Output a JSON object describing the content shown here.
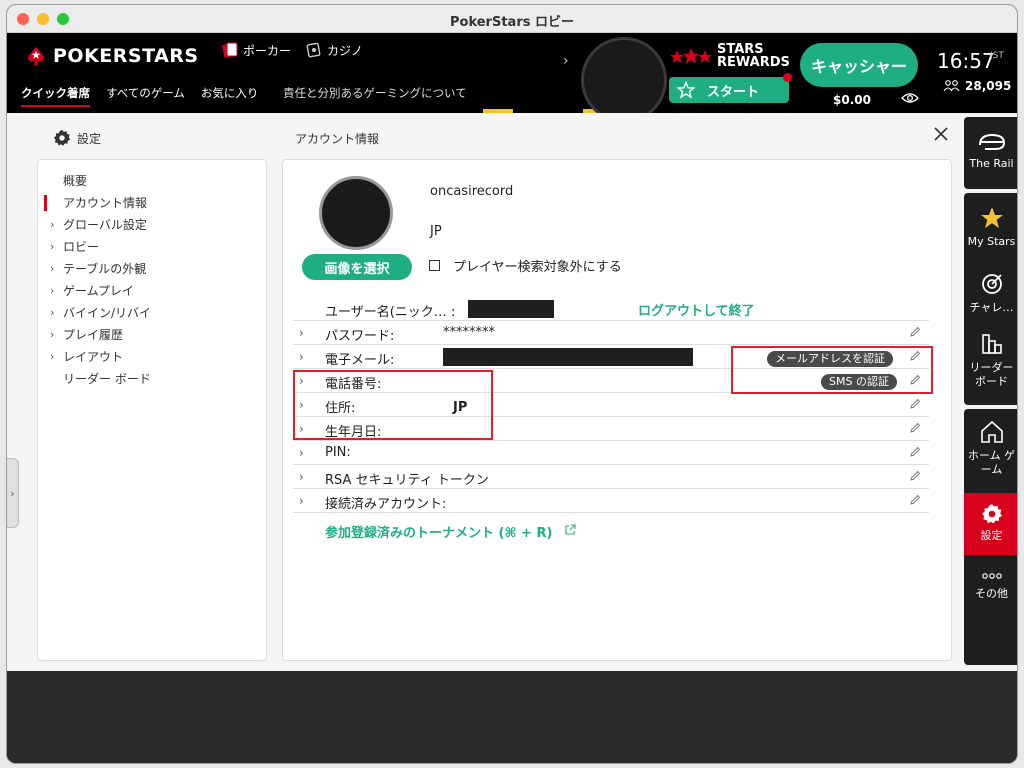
{
  "window": {
    "title": "PokerStars ロビー"
  },
  "header": {
    "logo_text": "POKERSTARS",
    "games": [
      {
        "label": "ポーカー",
        "icon": "cards-icon"
      },
      {
        "label": "カジノ",
        "icon": "casino-icon"
      }
    ],
    "tabs": [
      {
        "label": "クイック着席",
        "active": true
      },
      {
        "label": "すべてのゲーム"
      },
      {
        "label": "お気に入り"
      }
    ],
    "responsible_gaming": "責任と分別あるゲーミングについて",
    "rewards_line1": "STARS",
    "rewards_line2": "REWARDS",
    "start_label": "スタート",
    "cashier_label": "キャッシャー",
    "balance": "$0.00",
    "time": "16:57",
    "timezone": "JST",
    "players_online": "28,095"
  },
  "settings": {
    "panel_title": "設定",
    "section_title": "アカウント情報",
    "nav": [
      {
        "label": "概要",
        "chevron": false
      },
      {
        "label": "アカウント情報",
        "chevron": false,
        "active": true
      },
      {
        "label": "グローバル設定",
        "chevron": true
      },
      {
        "label": "ロビー",
        "chevron": true
      },
      {
        "label": "テーブルの外観",
        "chevron": true
      },
      {
        "label": "ゲームプレイ",
        "chevron": true
      },
      {
        "label": "バイイン/リバイ",
        "chevron": true
      },
      {
        "label": "プレイ履歴",
        "chevron": true
      },
      {
        "label": "レイアウト",
        "chevron": true
      },
      {
        "label": "リーダー ボード",
        "chevron": false
      }
    ]
  },
  "account": {
    "username": "oncasirecord",
    "country": "JP",
    "select_image_label": "画像を選択",
    "exclude_search_label": "プレイヤー検索対象外にする",
    "username_row_label": "ユーザー名(ニック…  :",
    "logout_label": "ログアウトして終了",
    "rows": [
      {
        "label": "パスワード:",
        "value": "********"
      },
      {
        "label": "電子メール:",
        "value": ""
      },
      {
        "label": "電話番号:",
        "value": ""
      },
      {
        "label": "住所:",
        "value": "JP"
      },
      {
        "label": "生年月日:",
        "value": ""
      },
      {
        "label": "PIN:",
        "value": ""
      },
      {
        "label": "RSA セキュリティ トークン",
        "value": ""
      },
      {
        "label": "接続済みアカウント:",
        "value": ""
      }
    ],
    "verify_email_label": "メールアドレスを認証",
    "verify_sms_label": "SMS の認証",
    "tournaments_link": "参加登録済みのトーナメント (⌘ + R)"
  },
  "rail": [
    {
      "label": "The Rail"
    },
    {
      "label": "My Stars"
    },
    {
      "label": "チャレ…"
    },
    {
      "label": "リーダー ボード"
    },
    {
      "label": "ホーム ゲーム"
    },
    {
      "label": "設定"
    },
    {
      "label": "その他"
    }
  ],
  "colors": {
    "accent_green": "#1fae83",
    "brand_red": "#d9001b",
    "highlight_red": "#e01f2b"
  }
}
